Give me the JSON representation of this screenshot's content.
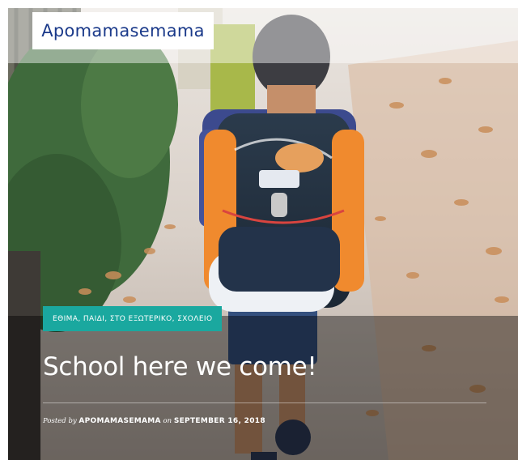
{
  "header": {
    "site_title": "Apomamasemama"
  },
  "post": {
    "categories": "ΕΘΙΜΑ, ΠΑΙΔΙ, ΣΤΟ ΕΞΩΤΕΡΙΚΟ, ΣΧΟΛΕΙΟ",
    "title": "School here we come!",
    "meta": {
      "posted_by_label": "Posted by",
      "author": "APOMAMASEMAMA",
      "on_label": "on",
      "date": "SEPTEMBER 16, 2018"
    },
    "featured_image": {
      "description_icon": "photo-child-with-school-backpack"
    }
  },
  "colors": {
    "brand": "#1b3a8a",
    "tag_bg": "#1aa89f",
    "overlay": "rgba(0,0,0,0.42)"
  }
}
